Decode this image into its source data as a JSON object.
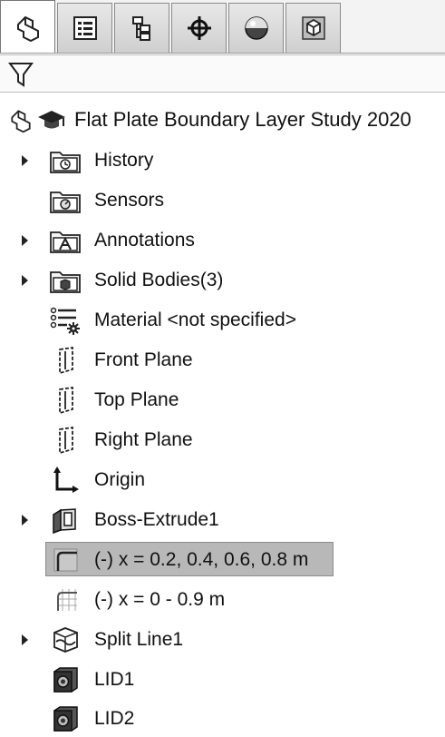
{
  "tabs": [
    {
      "icon": "feature-manager-icon",
      "active": true
    },
    {
      "icon": "property-manager-icon",
      "active": false
    },
    {
      "icon": "configuration-manager-icon",
      "active": false
    },
    {
      "icon": "dimxpert-manager-icon",
      "active": false
    },
    {
      "icon": "display-manager-icon",
      "active": false
    },
    {
      "icon": "cam-manager-icon",
      "active": false
    }
  ],
  "filter": {
    "icon": "funnel-icon"
  },
  "root": {
    "title": "Flat Plate Boundary Layer Study 2020"
  },
  "tree": [
    {
      "label": "History",
      "icon": "history-folder-icon",
      "expandable": true
    },
    {
      "label": "Sensors",
      "icon": "sensors-folder-icon",
      "expandable": false
    },
    {
      "label": "Annotations",
      "icon": "annotations-folder-icon",
      "expandable": true
    },
    {
      "label": "Solid Bodies(3)",
      "icon": "solid-bodies-folder-icon",
      "expandable": true
    },
    {
      "label": "Material <not specified>",
      "icon": "material-icon",
      "expandable": false
    },
    {
      "label": "Front Plane",
      "icon": "plane-icon",
      "expandable": false
    },
    {
      "label": "Top Plane",
      "icon": "plane-icon",
      "expandable": false
    },
    {
      "label": "Right Plane",
      "icon": "plane-icon",
      "expandable": false
    },
    {
      "label": "Origin",
      "icon": "origin-icon",
      "expandable": false
    },
    {
      "label": "Boss-Extrude1",
      "icon": "extrude-icon",
      "expandable": true
    },
    {
      "label": "(-) x = 0.2, 0.4, 0.6, 0.8 m",
      "icon": "sketch-icon",
      "expandable": false,
      "selected": true
    },
    {
      "label": "(-) x = 0 - 0.9 m",
      "icon": "sketch-grid-icon",
      "expandable": false
    },
    {
      "label": "Split Line1",
      "icon": "split-line-icon",
      "expandable": true
    },
    {
      "label": "LID1",
      "icon": "lid-icon",
      "expandable": false
    },
    {
      "label": "LID2",
      "icon": "lid-icon",
      "expandable": false
    }
  ]
}
